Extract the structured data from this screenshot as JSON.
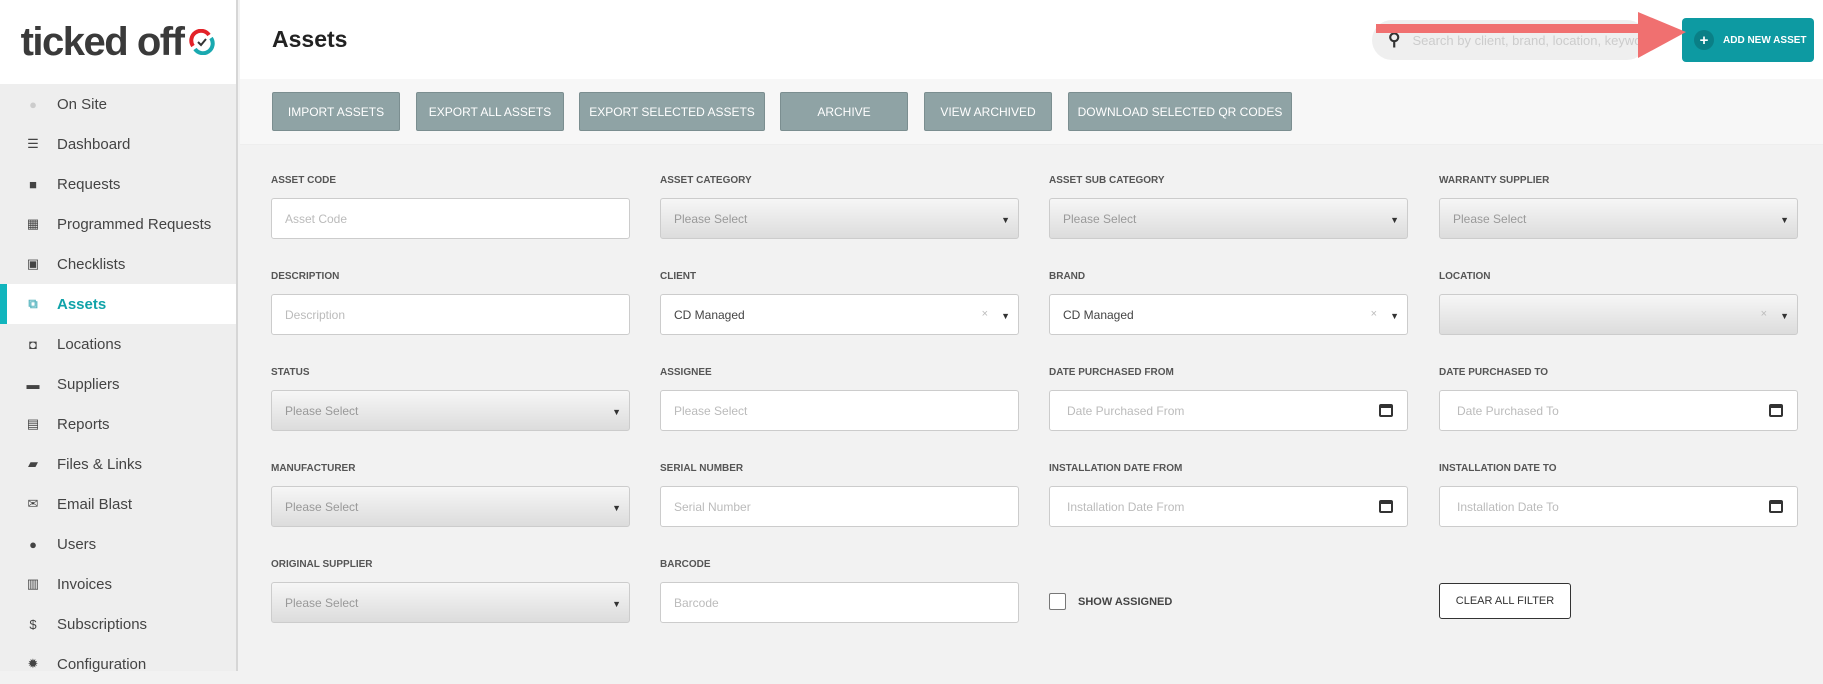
{
  "logo": {
    "text": "ticked off"
  },
  "sidebar": {
    "items": [
      {
        "label": "On Site",
        "icon": "status-dot-icon"
      },
      {
        "label": "Dashboard",
        "icon": "dashboard-icon"
      },
      {
        "label": "Requests",
        "icon": "chat-bubble-icon"
      },
      {
        "label": "Programmed Requests",
        "icon": "calendar-check-icon"
      },
      {
        "label": "Checklists",
        "icon": "clipboard-icon"
      },
      {
        "label": "Assets",
        "icon": "copy-squares-icon",
        "active": true
      },
      {
        "label": "Locations",
        "icon": "bag-check-icon"
      },
      {
        "label": "Suppliers",
        "icon": "truck-icon"
      },
      {
        "label": "Reports",
        "icon": "report-icon"
      },
      {
        "label": "Files & Links",
        "icon": "files-icon"
      },
      {
        "label": "Email Blast",
        "icon": "envelope-icon"
      },
      {
        "label": "Users",
        "icon": "user-icon"
      },
      {
        "label": "Invoices",
        "icon": "invoice-icon"
      },
      {
        "label": "Subscriptions",
        "icon": "dollar-icon"
      },
      {
        "label": "Configuration",
        "icon": "gear-icon"
      }
    ]
  },
  "header": {
    "title": "Assets",
    "search_placeholder": "Search by client, brand, location, keyword",
    "add_button": "ADD NEW ASSET"
  },
  "annotation": {
    "arrow_color": "#f07070"
  },
  "toolbar": {
    "buttons": [
      "IMPORT ASSETS",
      "EXPORT ALL ASSETS",
      "EXPORT SELECTED ASSETS",
      "ARCHIVE",
      "VIEW ARCHIVED",
      "DOWNLOAD SELECTED QR CODES"
    ]
  },
  "filters": {
    "asset_code": {
      "label": "ASSET CODE",
      "placeholder": "Asset Code"
    },
    "asset_category": {
      "label": "ASSET CATEGORY",
      "value": "Please Select"
    },
    "asset_sub_category": {
      "label": "ASSET SUB CATEGORY",
      "value": "Please Select"
    },
    "warranty_supplier": {
      "label": "WARRANTY SUPPLIER",
      "value": "Please Select"
    },
    "description": {
      "label": "DESCRIPTION",
      "placeholder": "Description"
    },
    "client": {
      "label": "CLIENT",
      "value": "CD Managed"
    },
    "brand": {
      "label": "BRAND",
      "value": "CD Managed"
    },
    "location": {
      "label": "LOCATION",
      "value": ""
    },
    "status": {
      "label": "STATUS",
      "value": "Please Select"
    },
    "assignee": {
      "label": "ASSIGNEE",
      "placeholder": "Please Select"
    },
    "date_purchased_from": {
      "label": "DATE PURCHASED FROM",
      "placeholder": "Date Purchased From"
    },
    "date_purchased_to": {
      "label": "DATE PURCHASED TO",
      "placeholder": "Date Purchased To"
    },
    "manufacturer": {
      "label": "MANUFACTURER",
      "value": "Please Select"
    },
    "serial_number": {
      "label": "SERIAL NUMBER",
      "placeholder": "Serial Number"
    },
    "installation_date_from": {
      "label": "INSTALLATION DATE FROM",
      "placeholder": "Installation Date From"
    },
    "installation_date_to": {
      "label": "INSTALLATION DATE TO",
      "placeholder": "Installation Date To"
    },
    "original_supplier": {
      "label": "ORIGINAL SUPPLIER",
      "value": "Please Select"
    },
    "barcode": {
      "label": "BARCODE",
      "placeholder": "Barcode"
    },
    "show_assigned": {
      "label": "SHOW ASSIGNED",
      "checked": false
    },
    "clear_all": "CLEAR ALL FILTER"
  },
  "colors": {
    "accent": "#0d9aa2",
    "toolbar_button": "#8fa3a5"
  }
}
